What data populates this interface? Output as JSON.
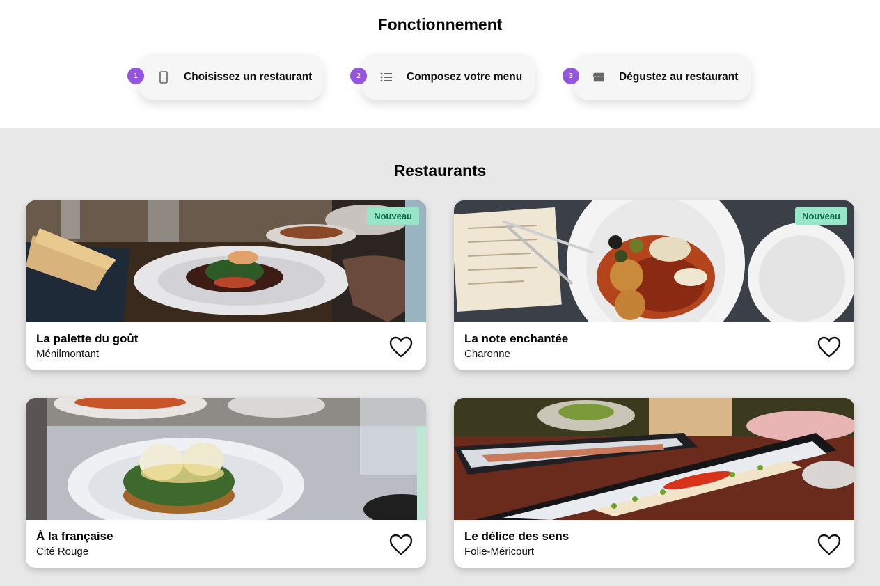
{
  "how_it_works": {
    "title": "Fonctionnement",
    "steps": [
      {
        "number": "1",
        "icon": "smartphone-icon",
        "label": "Choisissez un restaurant"
      },
      {
        "number": "2",
        "icon": "list-icon",
        "label": "Composez votre menu"
      },
      {
        "number": "3",
        "icon": "storefront-icon",
        "label": "Dégustez au restaurant"
      }
    ]
  },
  "restaurants": {
    "title": "Restaurants",
    "items": [
      {
        "name": "La palette du goût",
        "area": "Ménilmontant",
        "badge": "Nouveau",
        "favorite_icon": "heart-outline-icon"
      },
      {
        "name": "La note enchantée",
        "area": "Charonne",
        "badge": "Nouveau",
        "favorite_icon": "heart-outline-icon"
      },
      {
        "name": "À la française",
        "area": "Cité Rouge",
        "favorite_icon": "heart-outline-icon"
      },
      {
        "name": "Le délice des sens",
        "area": "Folie-Méricourt",
        "favorite_icon": "heart-outline-icon"
      }
    ]
  },
  "colors": {
    "step_badge": "#9356dc",
    "new_badge_bg": "#99e5c8",
    "new_badge_text": "#0c6b48",
    "section_bg": "#e8e8e8"
  }
}
